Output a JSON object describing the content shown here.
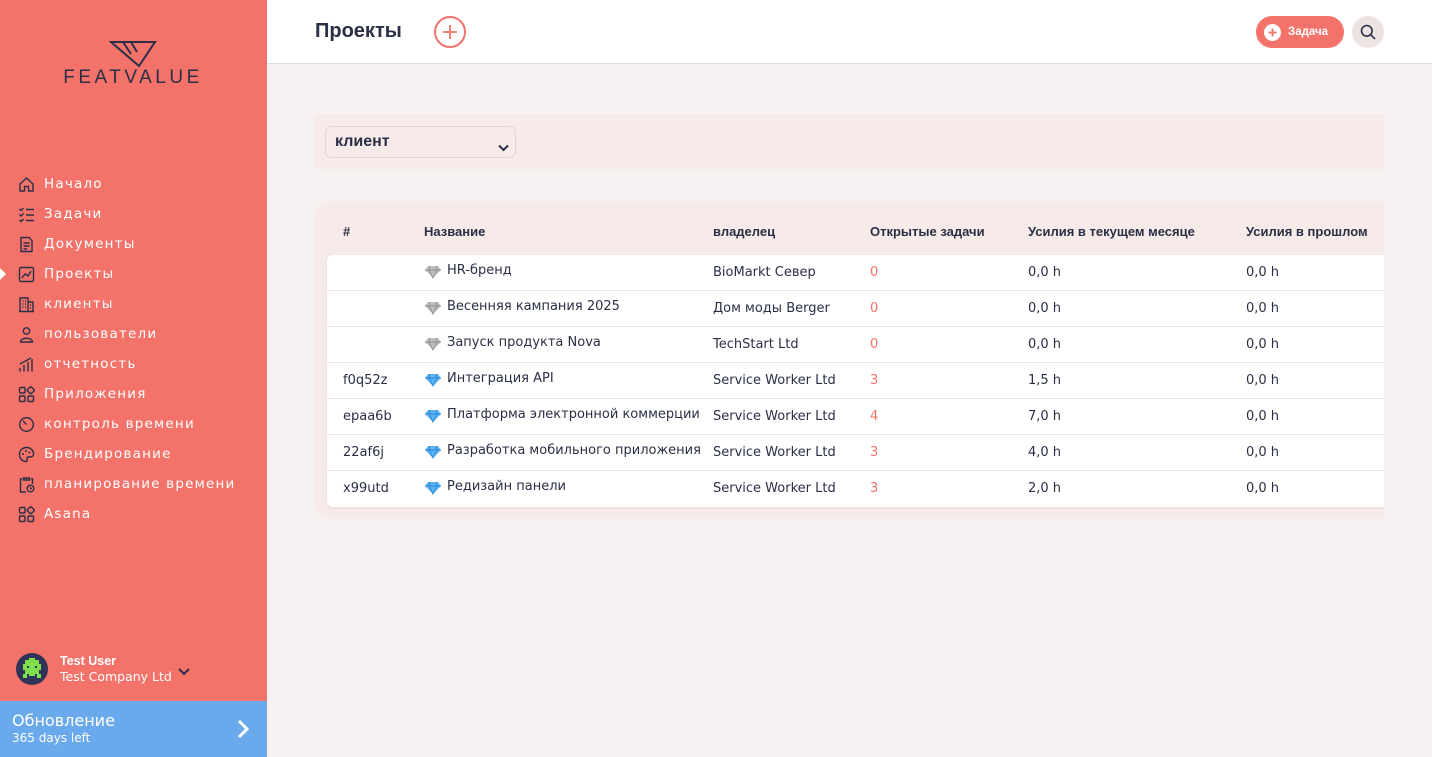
{
  "brand": {
    "logo_text": "FEATVALUE"
  },
  "sidebar": {
    "items": [
      {
        "label": "Начало",
        "icon": "home-icon"
      },
      {
        "label": "Задачи",
        "icon": "tasks-icon"
      },
      {
        "label": "Документы",
        "icon": "document-icon"
      },
      {
        "label": "Проекты",
        "icon": "projects-icon",
        "active": true
      },
      {
        "label": "клиенты",
        "icon": "building-icon"
      },
      {
        "label": "пользователи",
        "icon": "user-icon"
      },
      {
        "label": "отчетность",
        "icon": "chart-icon"
      },
      {
        "label": "Приложения",
        "icon": "apps-icon"
      },
      {
        "label": "контроль времени",
        "icon": "timer-icon"
      },
      {
        "label": "Брендирование",
        "icon": "palette-icon"
      },
      {
        "label": "планирование времени",
        "icon": "clipboard-clock-icon"
      },
      {
        "label": "Asana",
        "icon": "apps-icon"
      }
    ],
    "user": {
      "name": "Test User",
      "company": "Test Company Ltd"
    },
    "update": {
      "title": "Обновление",
      "subtitle": "365 days left"
    }
  },
  "header": {
    "title": "Проекты",
    "task_button": "Задача"
  },
  "filter": {
    "selected": "клиент"
  },
  "table": {
    "columns": [
      "#",
      "Название",
      "владелец",
      "Открытые задачи",
      "Усилия в текущем месяце",
      "Усилия в прошлом"
    ],
    "rows": [
      {
        "id": "",
        "name": "HR-бренд",
        "gem": "grey",
        "owner": "BioMarkt Север",
        "open": "0",
        "current": "0,0 h",
        "previous": "0,0 h"
      },
      {
        "id": "",
        "name": "Весенняя кампания 2025",
        "gem": "grey",
        "owner": "Дом моды Berger",
        "open": "0",
        "current": "0,0 h",
        "previous": "0,0 h"
      },
      {
        "id": "",
        "name": "Запуск продукта Nova",
        "gem": "grey",
        "owner": "TechStart Ltd",
        "open": "0",
        "current": "0,0 h",
        "previous": "0,0 h"
      },
      {
        "id": "f0q52z",
        "name": "Интеграция API",
        "gem": "blue",
        "owner": "Service Worker Ltd",
        "open": "3",
        "current": "1,5 h",
        "previous": "0,0 h"
      },
      {
        "id": "epaa6b",
        "name": "Платформа электронной коммерции",
        "gem": "blue",
        "owner": "Service Worker Ltd",
        "open": "4",
        "current": "7,0 h",
        "previous": "0,0 h"
      },
      {
        "id": "22af6j",
        "name": "Разработка мобильного приложения",
        "gem": "blue",
        "owner": "Service Worker Ltd",
        "open": "3",
        "current": "4,0 h",
        "previous": "0,0 h"
      },
      {
        "id": "x99utd",
        "name": "Редизайн панели",
        "gem": "blue",
        "owner": "Service Worker Ltd",
        "open": "3",
        "current": "2,0 h",
        "previous": "0,0 h"
      }
    ]
  },
  "colors": {
    "accent": "#f3736a",
    "update_bar": "#6aa9ec",
    "text": "#2a2f45"
  }
}
